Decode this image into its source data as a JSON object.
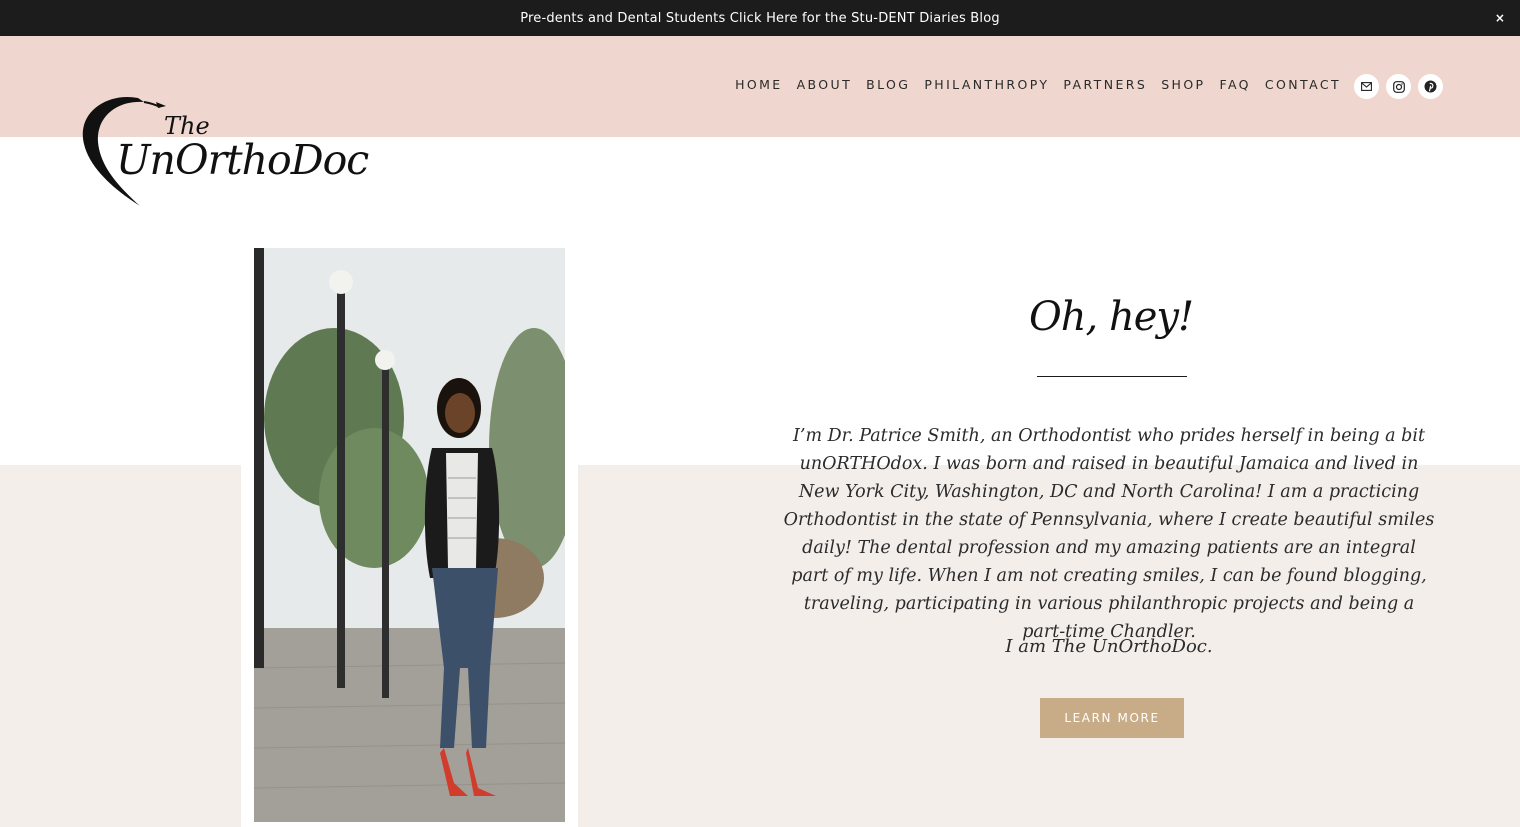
{
  "announcement": {
    "text": "Pre-dents and Dental Students Click Here for the Stu-DENT Diaries Blog",
    "close_glyph": "×"
  },
  "header": {
    "background_color": "#efd7cf",
    "logo": {
      "line1": "The",
      "line2": "UnOrthoDoc"
    },
    "nav": [
      {
        "label": "HOME"
      },
      {
        "label": "ABOUT"
      },
      {
        "label": "BLOG"
      },
      {
        "label": "PHILANTHROPY"
      },
      {
        "label": "PARTNERS"
      },
      {
        "label": "SHOP"
      },
      {
        "label": "FAQ"
      },
      {
        "label": "CONTACT"
      }
    ],
    "social": [
      {
        "icon": "mail-icon"
      },
      {
        "icon": "instagram-icon"
      },
      {
        "icon": "pinterest-icon"
      }
    ]
  },
  "hero": {
    "heading": "Oh, hey!",
    "paragraph": "I’m Dr. Patrice Smith, an Orthodontist who prides herself in being a bit unORTHOdox. I was born and raised in beautiful Jamaica and lived in New York City, Washington, DC and North Carolina! I am a practicing Orthodontist in the state of Pennsylvania, where I create beautiful smiles daily! The dental profession and my amazing patients are an integral part of my life. When I am not creating smiles, I can be found blogging, traveling, participating in various philanthropic projects and being a part-time Chandler.",
    "tagline": "I am The UnOrthoDoc.",
    "button_label": "LEARN MORE",
    "button_color": "#c8ac87",
    "band_color": "#f4eeeb"
  }
}
